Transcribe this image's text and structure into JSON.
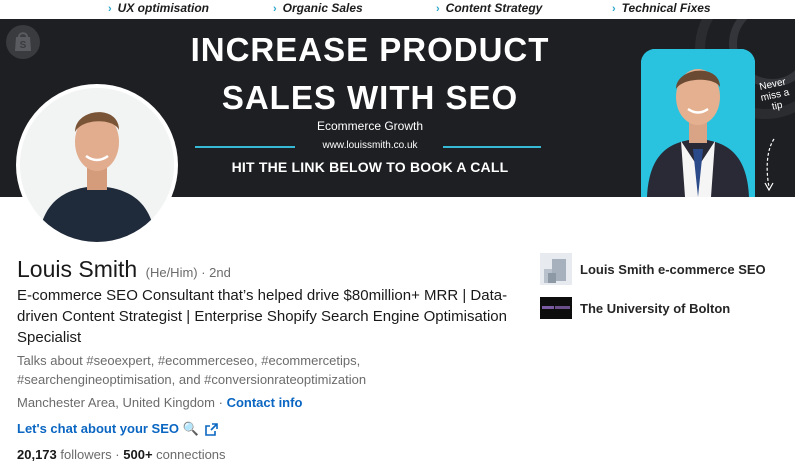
{
  "top_strip": {
    "items": [
      "UX optimisation",
      "Organic Sales",
      "Content Strategy",
      "Technical Fixes"
    ]
  },
  "banner": {
    "headline_line1": "INCREASE PRODUCT",
    "headline_line2": "SALES WITH SEO",
    "subtitle": "Ecommerce Growth",
    "website": "www.louissmith.co.uk",
    "cta": "HIT THE LINK BELOW TO BOOK A CALL",
    "side_note": "Never miss a tip"
  },
  "profile": {
    "name": "Louis Smith",
    "pronouns": "(He/Him)",
    "degree": " · 2nd",
    "headline": "E-commerce SEO Consultant that’s helped drive $80million+ MRR | Data-driven Content Strategist | Enterprise Shopify Search Engine Optimisation Specialist",
    "talks_about": "Talks about #seoexpert, #ecommerceseo, #ecommercetips, #searchengineoptimisation, and #conversionrateoptimization",
    "location": "Manchester Area, United Kingdom",
    "location_sep": " · ",
    "contact_info": "Contact info",
    "chat_link": "Let's chat about your SEO 🔍",
    "followers_count": "20,173",
    "followers_label": " followers",
    "stats_sep": " · ",
    "connections_count": "500+",
    "connections_label": " connections"
  },
  "organizations": [
    {
      "name": "Louis Smith e-commerce SEO"
    },
    {
      "name": "The University of Bolton"
    }
  ],
  "colors": {
    "link_blue": "#0a66c2",
    "banner_bg": "#1e1f22",
    "accent_cyan": "#29c3df"
  }
}
